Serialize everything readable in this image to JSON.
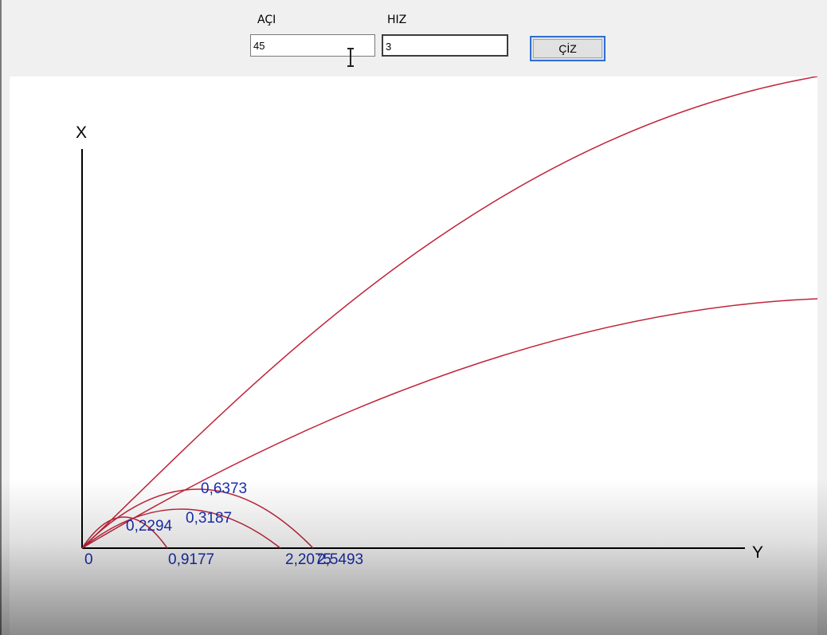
{
  "form": {
    "angle_label": "AÇI",
    "angle_value": "45",
    "speed_label": "HIZ",
    "speed_value": "3",
    "draw_button": "ÇİZ"
  },
  "chart_data": {
    "type": "line",
    "xlabel": "Y",
    "ylabel": "X",
    "series": [
      {
        "peak_label": "0,2294",
        "range_label": "0,9177"
      },
      {
        "peak_label": "0,3187",
        "range_label": "2,2075"
      },
      {
        "peak_label": "0,6373",
        "range_label": "2,5493"
      }
    ],
    "origin_label": "0",
    "colors": {
      "curve": "#c0243a",
      "axis": "#000000",
      "label": "#1c2fb0"
    }
  }
}
